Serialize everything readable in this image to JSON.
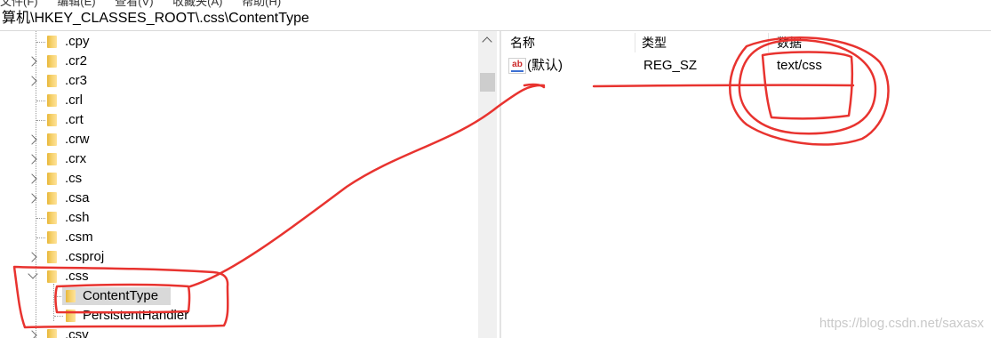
{
  "menubar": {
    "items": [
      "文件(F)",
      "编辑(E)",
      "查看(V)",
      "收藏夹(A)",
      "帮助(H)"
    ]
  },
  "address": {
    "path": "算机\\HKEY_CLASSES_ROOT\\.css\\ContentType"
  },
  "tree": {
    "items": [
      {
        "label": ".cpy",
        "expander": "none"
      },
      {
        "label": ".cr2",
        "expander": "collapsed"
      },
      {
        "label": ".cr3",
        "expander": "collapsed"
      },
      {
        "label": ".crl",
        "expander": "none"
      },
      {
        "label": ".crt",
        "expander": "none"
      },
      {
        "label": ".crw",
        "expander": "collapsed"
      },
      {
        "label": ".crx",
        "expander": "collapsed"
      },
      {
        "label": ".cs",
        "expander": "collapsed"
      },
      {
        "label": ".csa",
        "expander": "collapsed"
      },
      {
        "label": ".csh",
        "expander": "none"
      },
      {
        "label": ".csm",
        "expander": "none"
      },
      {
        "label": ".csproj",
        "expander": "collapsed"
      },
      {
        "label": ".css",
        "expander": "expanded"
      },
      {
        "label": ".csv",
        "expander": "collapsed"
      }
    ],
    "children": [
      {
        "label": "ContentType",
        "selected": true
      },
      {
        "label": "PersistentHandler",
        "selected": false
      }
    ]
  },
  "list": {
    "headers": {
      "name": "名称",
      "type": "类型",
      "data": "数据"
    },
    "rows": [
      {
        "icon": "string-value-icon",
        "icon_text": "ab",
        "name": "(默认)",
        "type": "REG_SZ",
        "data": "text/css"
      }
    ]
  },
  "watermark": "https://blog.csdn.net/saxasx",
  "colors": {
    "annotation": "#e8332f",
    "selection": "#d9d9d9",
    "folder": "#f5d06b"
  }
}
